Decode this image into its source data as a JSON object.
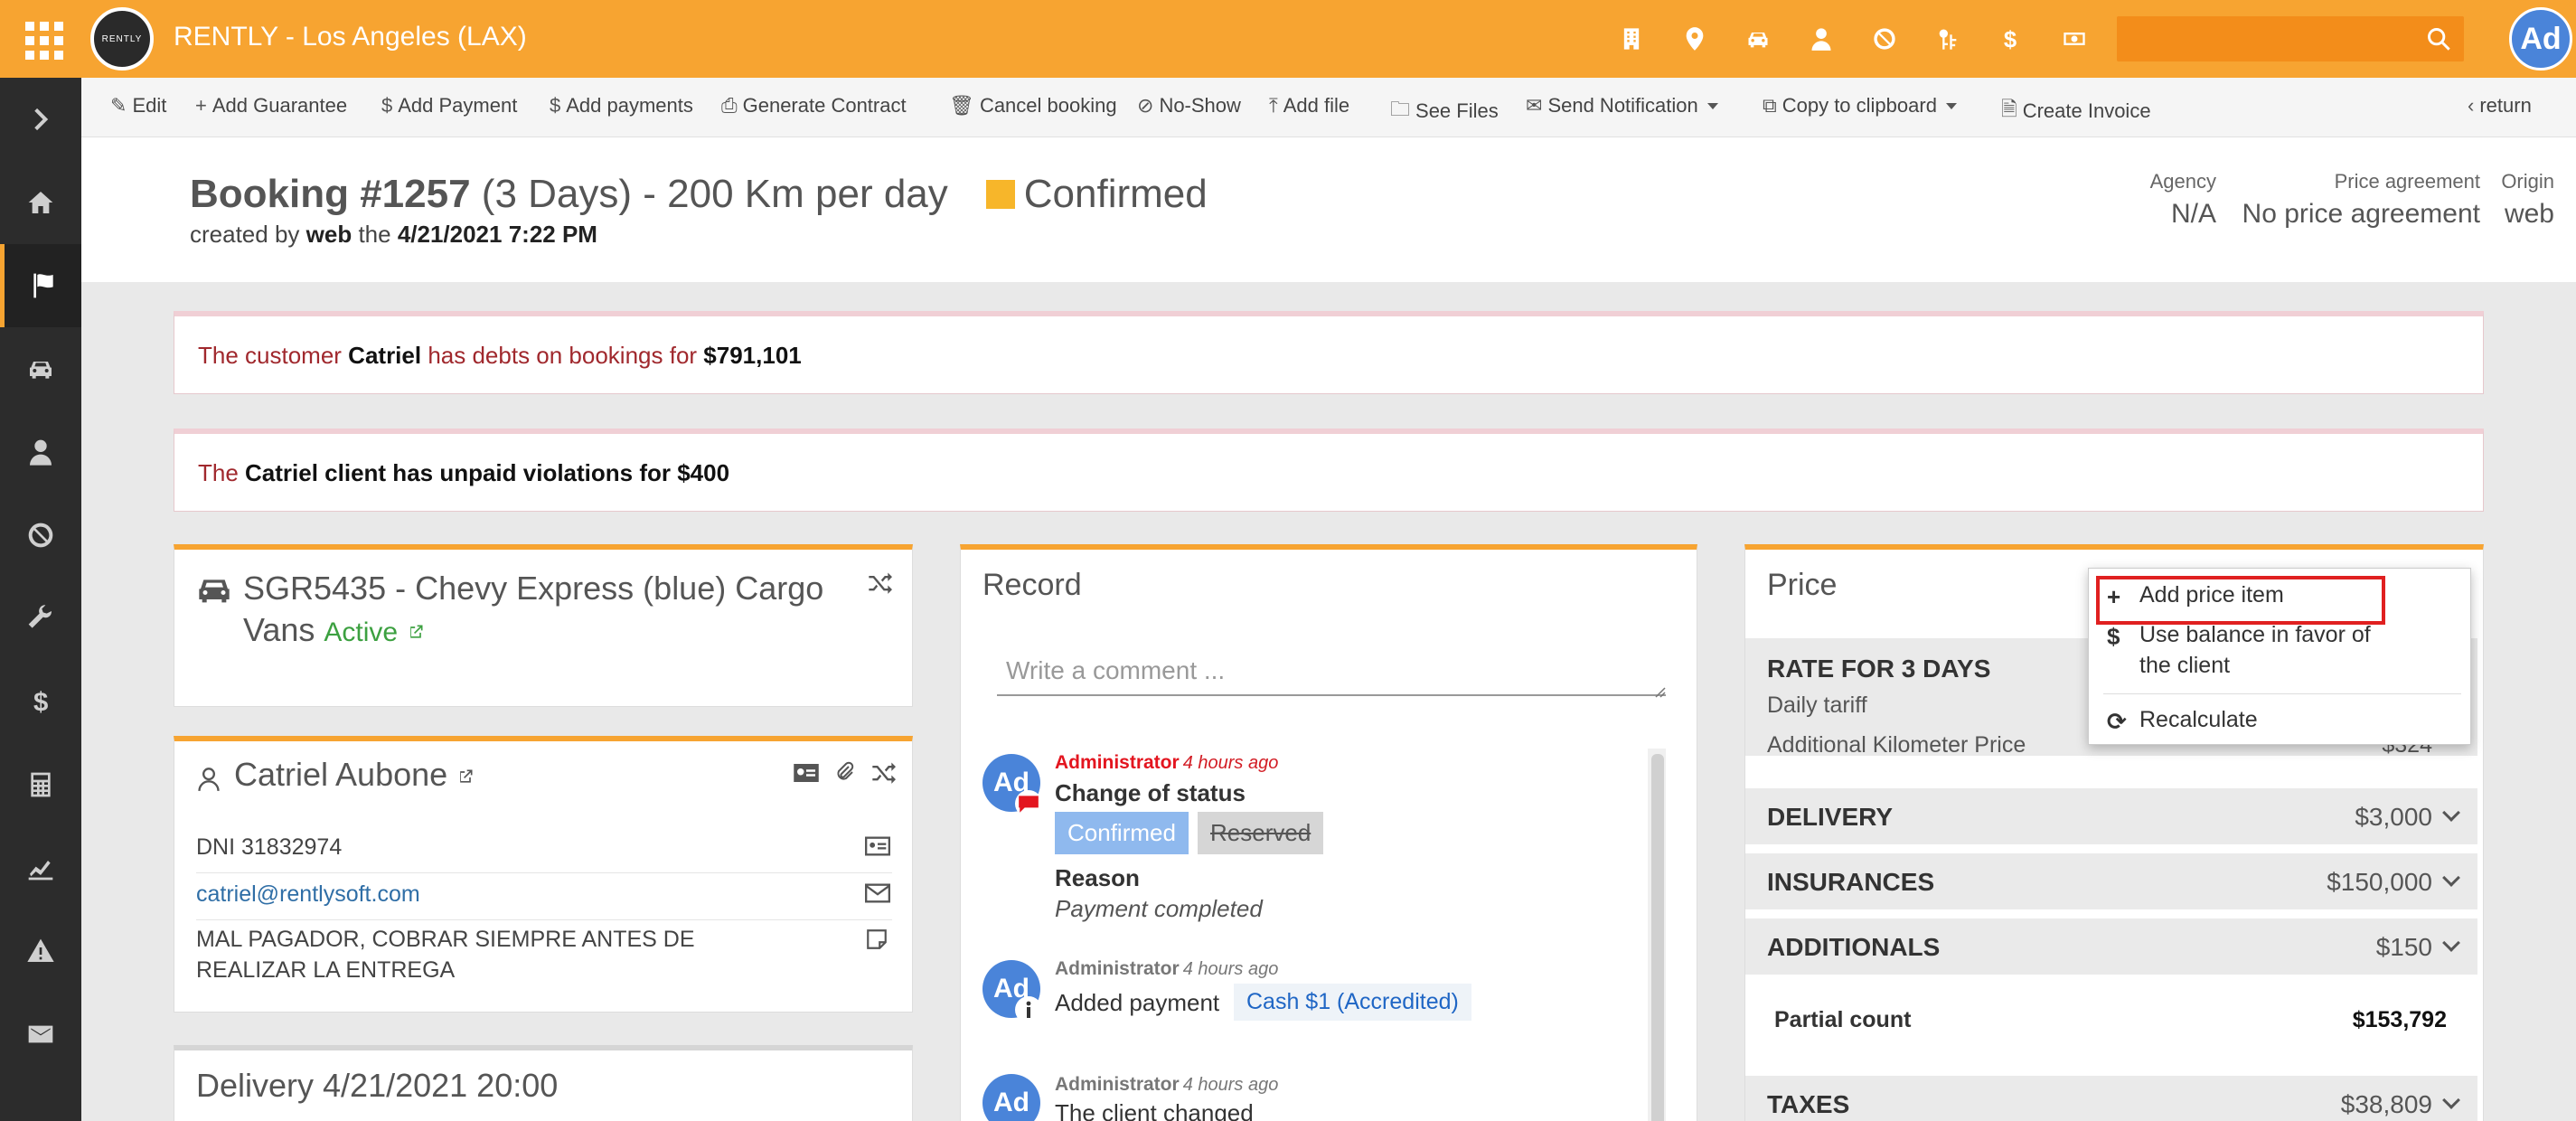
{
  "app": {
    "title": "RENTLY - Los Angeles (LAX)",
    "logo_text": "RENTLY",
    "avatar_initials": "Ad",
    "search_placeholder": "",
    "top_icons": [
      "building-icon",
      "map-pin-icon",
      "car-icon",
      "user-icon",
      "ban-icon",
      "keys-icon",
      "dollar-icon",
      "cash-icon"
    ]
  },
  "colors": {
    "brand": "#f7a431",
    "sidebar": "#2c2c2c",
    "alert_text": "#a0282d",
    "active_green": "#3ca040",
    "link_blue": "#2f6ea6",
    "avatar_blue": "#4a84d9",
    "highlight_red": "#e02020",
    "status_confirmed": "#f7b62a"
  },
  "sidebar": {
    "items": [
      "chevron-right-icon",
      "home-icon",
      "flag-icon",
      "car-icon",
      "user-icon",
      "ban-icon",
      "wrench-icon",
      "dollar-icon",
      "calculator-icon",
      "chart-icon",
      "warning-icon",
      "envelope-icon"
    ],
    "active": "flag-icon"
  },
  "toolbar": {
    "edit": "Edit",
    "add_guarantee": "Add Guarantee",
    "add_payment": "Add Payment",
    "add_payments": "Add payments",
    "generate_contract": "Generate Contract",
    "cancel_booking": "Cancel booking",
    "no_show": "No-Show",
    "add_file": "Add file",
    "see_files": "See Files",
    "send_notification": "Send Notification",
    "copy_clipboard": "Copy to clipboard",
    "create_invoice": "Create Invoice",
    "return": "return"
  },
  "header": {
    "booking_number": "Booking #1257",
    "booking_detail": " (3 Days) - 200 Km per day",
    "status": "Confirmed",
    "created_prefix": "created by ",
    "created_by": "web",
    "created_mid": " the ",
    "created_date": "4/21/2021 7:22 PM",
    "agency_label": "Agency",
    "agency_value": "N/A",
    "price_agreement_label": "Price agreement",
    "price_agreement_value": "No price agreement",
    "origin_label": "Origin",
    "origin_value": "web"
  },
  "alerts": {
    "debts_prefix": "The customer ",
    "debts_customer": "Catriel",
    "debts_mid": " has debts on bookings for ",
    "debts_amount": "$791,101",
    "violations_prefix": "The ",
    "violations_text": "Catriel client has unpaid violations for $400"
  },
  "vehicle": {
    "title": "SGR5435 - Chevy Express (blue) Cargo Vans",
    "status": "Active"
  },
  "customer": {
    "name": "Catriel Aubone",
    "dni": "DNI 31832974",
    "email": "catriel@rentlysoft.com",
    "note": "MAL PAGADOR, COBRAR SIEMPRE ANTES DE REALIZAR LA ENTREGA"
  },
  "delivery": {
    "title": "Delivery 4/21/2021 20:00"
  },
  "record": {
    "title": "Record",
    "comment_placeholder": "Write a comment ...",
    "entries": [
      {
        "author": "Administrator",
        "time": "4 hours ago",
        "title": "Change of status",
        "from": "Confirmed",
        "to": "Reserved",
        "reason_label": "Reason",
        "reason": "Payment completed"
      },
      {
        "author": "Administrator",
        "time": "4 hours ago",
        "text": "Added payment",
        "tag": "Cash $1 (Accredited)"
      },
      {
        "author": "Administrator",
        "time": "4 hours ago",
        "text": "The client changed"
      }
    ]
  },
  "price": {
    "title": "Price",
    "rate_title": "RATE FOR 3 DAYS",
    "daily_tariff": "Daily tariff",
    "additional_km": "Additional Kilometer Price",
    "additional_km_value": "$324",
    "delivery_label": "DELIVERY",
    "delivery_value": "$3,000",
    "insurances_label": "INSURANCES",
    "insurances_value": "$150,000",
    "additionals_label": "ADDITIONALS",
    "additionals_value": "$150",
    "partial_label": "Partial count",
    "partial_value": "$153,792",
    "taxes_label": "TAXES",
    "taxes_value": "$38,809"
  },
  "price_menu": {
    "add_price_item": "Add price item",
    "use_balance_line1": "Use balance in favor of",
    "use_balance_line2": "the client",
    "recalculate": "Recalculate"
  }
}
